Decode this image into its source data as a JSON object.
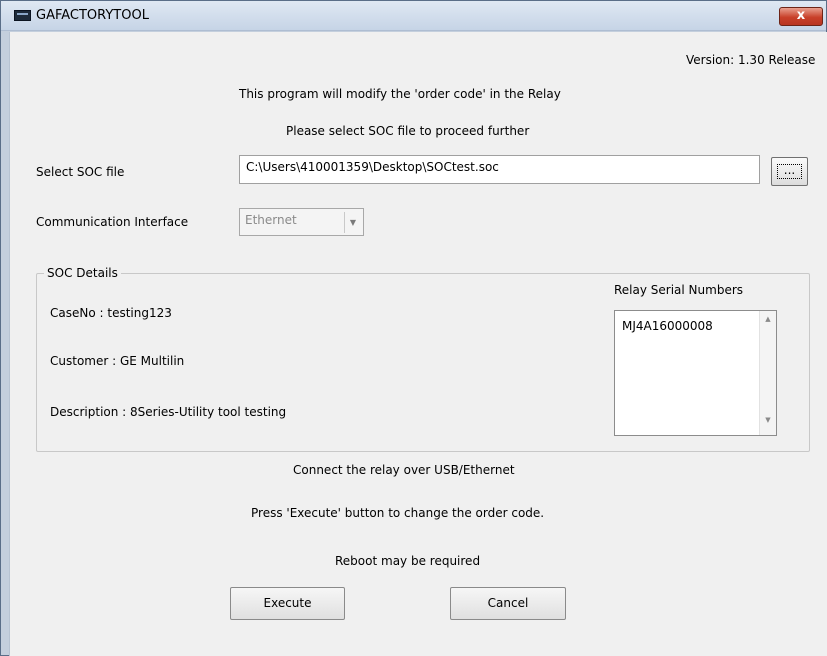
{
  "window": {
    "title": "GAFACTORYTOOL",
    "close_label": "x"
  },
  "header": {
    "version": "Version: 1.30 Release",
    "intro": "This program will modify the 'order code' in the Relay",
    "instruction": "Please select SOC file to proceed further"
  },
  "soc_file": {
    "label": "Select SOC file",
    "value": "C:\\Users\\410001359\\Desktop\\SOCtest.soc",
    "browse_label": "..."
  },
  "interface": {
    "label": "Communication  Interface",
    "selected": "Ethernet"
  },
  "soc_details": {
    "title": "SOC Details",
    "case_no": "CaseNo : testing123",
    "customer": "Customer : GE Multilin",
    "description": "Description : 8Series-Utility tool testing",
    "serial_label": "Relay Serial Numbers",
    "serial_numbers": [
      "MJ4A16000008"
    ]
  },
  "footer": {
    "connect": "Connect the relay over USB/Ethernet",
    "press_execute": "Press 'Execute' button to change the order code.",
    "reboot": "Reboot may be required"
  },
  "actions": {
    "execute_label": "Execute",
    "cancel_label": "Cancel"
  },
  "icons": {
    "app": "app-window-icon",
    "close": "close-icon",
    "dropdown": "chevron-down-icon"
  },
  "colors": {
    "frame": "#c4cfdd",
    "client": "#f0f0f0",
    "close_button": "#c8402a"
  }
}
